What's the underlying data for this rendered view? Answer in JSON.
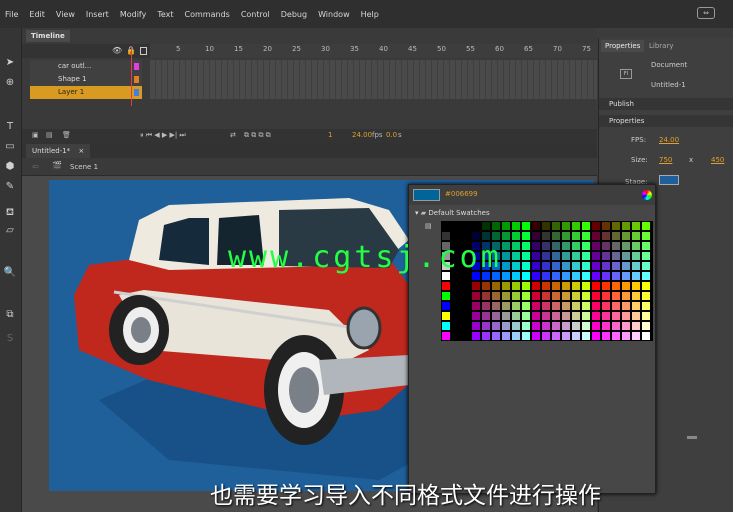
{
  "menu": [
    "File",
    "Edit",
    "View",
    "Insert",
    "Modify",
    "Text",
    "Commands",
    "Control",
    "Debug",
    "Window",
    "Help"
  ],
  "timeline": {
    "tab": "Timeline",
    "ruler": [
      "5",
      "10",
      "15",
      "20",
      "25",
      "30",
      "35",
      "40",
      "45",
      "50",
      "55",
      "60",
      "65",
      "70",
      "75"
    ],
    "layers": [
      {
        "name": "car outl...",
        "color": "#e040e0",
        "active": false
      },
      {
        "name": "Shape 1",
        "color": "#e08020",
        "active": false
      },
      {
        "name": "Layer 1",
        "color": "#4080e0",
        "active": true
      }
    ],
    "frame": "1",
    "fps": "24.00",
    "fps_unit": "fps",
    "time": "0.0",
    "time_unit": "s"
  },
  "document": {
    "tab": "Untitled-1*",
    "close": "×",
    "scene": "Scene 1"
  },
  "properties": {
    "tabs": [
      "Properties",
      "Library"
    ],
    "doc_label": "Document",
    "doc_name": "Untitled-1",
    "publish": "Publish",
    "section": "Properties",
    "fps_label": "FPS:",
    "fps_value": "24.00",
    "size_label": "Size:",
    "width": "750",
    "x": "x",
    "height": "450",
    "stage_label": "Stage:",
    "stage_color": "#1f5f9a"
  },
  "swatches": {
    "hex": "#006699",
    "group": "Default Swatches",
    "current_color": "#006699"
  },
  "watermark": "www.cgtsj.com",
  "subtitle": "也需要学习导入不同格式文件进行操作"
}
